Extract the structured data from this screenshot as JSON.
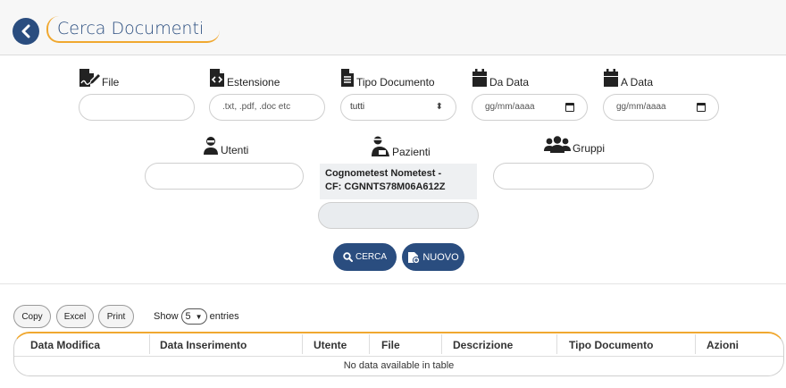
{
  "header": {
    "title": "Cerca Documenti"
  },
  "filters": {
    "file": {
      "label": "File",
      "value": ""
    },
    "estensione": {
      "label": "Estensione",
      "placeholder": ".txt, .pdf, .doc etc"
    },
    "tipo_documento": {
      "label": "Tipo Documento",
      "selected": "tutti"
    },
    "da_data": {
      "label": "Da Data",
      "placeholder": "gg/mm/aaaa"
    },
    "a_data": {
      "label": "A Data",
      "placeholder": "gg/mm/aaaa"
    },
    "utenti": {
      "label": "Utenti",
      "value": ""
    },
    "pazienti": {
      "label": "Pazienti",
      "selected_line1": "Cognometest Nometest -",
      "selected_line2": "CF: CGNNTS78M06A612Z",
      "value": ""
    },
    "gruppi": {
      "label": "Gruppi",
      "value": ""
    }
  },
  "actions": {
    "search_label": "CERCA",
    "new_label": "NUOVO"
  },
  "table_tools": {
    "copy_label": "Copy",
    "excel_label": "Excel",
    "print_label": "Print",
    "show_label": "Show",
    "entries_value": "5",
    "entries_label": "entries"
  },
  "table": {
    "columns": [
      "Data Modifica",
      "Data Inserimento",
      "Utente",
      "File",
      "Descrizione",
      "Tipo Documento",
      "Azioni"
    ],
    "empty_message": "No data available in table"
  },
  "colors": {
    "primary": "#2a4d7f",
    "accent": "#f0a830"
  }
}
